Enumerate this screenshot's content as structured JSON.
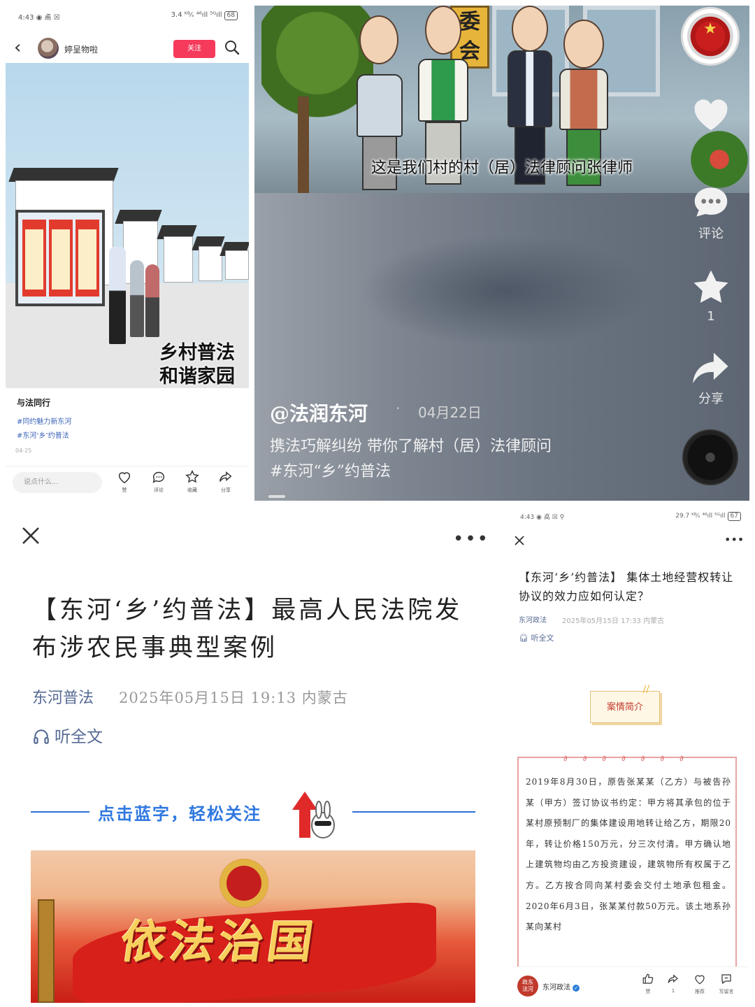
{
  "panel_a": {
    "status_left": "4:43 ◉ 卨 ☒",
    "status_right": "3.4 ᴷᴮ⁄ₛ ⁴⁶ıll ⁵ᴳıll",
    "battery": "68",
    "user_name": "婷呈物啦",
    "follow_label": "关注",
    "image_caption_line1": "乡村普法",
    "image_caption_line2": "和谐家园",
    "post_title": "与法同行",
    "tags": [
      "#同约魅力新东河",
      "#东河‘乡’约普法"
    ],
    "date": "04-25",
    "comment_placeholder": "说点什么...",
    "actions": {
      "like": "赞",
      "comment": "评论",
      "collect": "收藏",
      "share": "分享"
    }
  },
  "panel_b": {
    "sign_text": "委\n会",
    "subtitle": "这是我们村的村（居）法律顾问张律师",
    "side": {
      "comment": "评论",
      "favorite_count": "1",
      "share": "分享"
    },
    "author": "@法润东河",
    "dot": "·",
    "date": "04月22日",
    "description": "携法巧解纠纷 带你了解村（居）法律顾问",
    "hashtag": "#东河“乡”约普法"
  },
  "panel_c": {
    "title": "【东河‘乡’约普法】最高人民法院发布涉农民事典型案例",
    "source": "东河普法",
    "time": "2025年05月15日  19:13  内蒙古",
    "listen": "听全文",
    "follow_prompt": "点击蓝字，轻松关注",
    "banner_text": "依法治国"
  },
  "panel_d": {
    "status_left": "4:43 ◉ 卨 ☒ ⚲",
    "status_right": "29.7 ᴷᴮ⁄ₛ ⁴⁶ıll ⁵ᴳıll",
    "battery": "67",
    "title": "【东河‘乡’约普法】 集体土地经营权转让协议的效力应如何认定？",
    "source": "东河政法",
    "time": "2025年05月15日  17:33  内蒙古",
    "listen": "听全文",
    "case_tab": "案情简介",
    "body": "2019年8月30日，原告张某某（乙方）与被告孙某（甲方）签订协议书约定：甲方将其承包的位于某村原预制厂的集体建设用地转让给乙方，期限20年，转让价格150万元，分三次付清。甲方确认地上建筑物均由乙方投资建设，建筑物所有权属于乙方。乙方按合同向某村委会交付土地承包租金。2020年6月3日，张某某付款50万元。该土地系孙某向某村",
    "account": "东河政法",
    "logo_text": "政东\n法河",
    "actions": {
      "like": "赞",
      "like_count_hint": "",
      "share": "1",
      "recommend": "推荐",
      "comment": "写留言"
    }
  }
}
